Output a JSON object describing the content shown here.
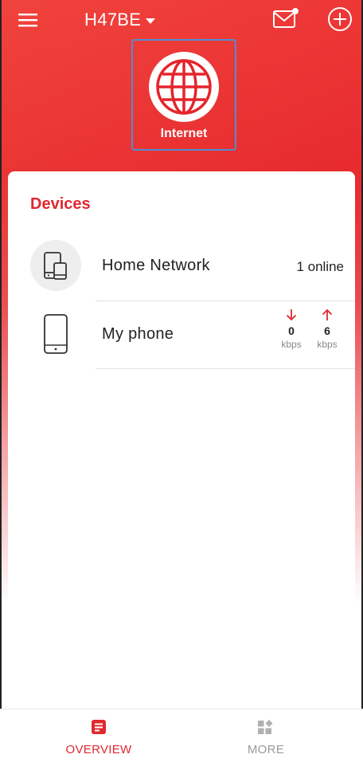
{
  "colors": {
    "brand_red": "#e5242b",
    "accent_red": "#e0282f",
    "tile_border": "#4d8fd1",
    "muted_gray": "#9a9a9a"
  },
  "header": {
    "menu_icon": "hamburger-menu-icon",
    "title": "H47BE",
    "title_dropdown_icon": "caret-down-icon",
    "mail_icon": "mail-notification-icon",
    "add_icon": "add-circle-icon"
  },
  "internet": {
    "icon": "globe-icon",
    "label": "Internet"
  },
  "devices": {
    "title": "Devices",
    "rows": [
      {
        "icon": "multi-device-icon",
        "label": "Home Network",
        "status": "1 online"
      },
      {
        "icon": "phone-icon",
        "label": "My phone",
        "download": {
          "icon": "arrow-down-icon",
          "value": "0",
          "unit": "kbps"
        },
        "upload": {
          "icon": "arrow-up-icon",
          "value": "6",
          "unit": "kbps"
        }
      }
    ]
  },
  "bottom_nav": {
    "items": [
      {
        "label": "OVERVIEW",
        "icon": "overview-doc-icon",
        "active": true
      },
      {
        "label": "MORE",
        "icon": "grid-apps-icon",
        "active": false
      }
    ]
  }
}
